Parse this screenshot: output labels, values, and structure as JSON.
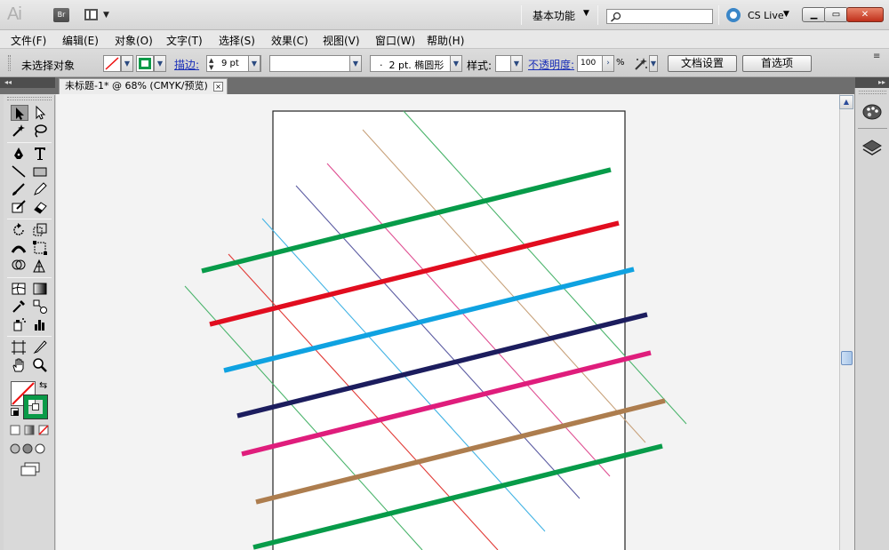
{
  "titlebar": {
    "app_logo": "Ai",
    "bridge_label": "Br",
    "workspace": "基本功能",
    "cs_live": "CS Live"
  },
  "menu": [
    "文件(F)",
    "编辑(E)",
    "对象(O)",
    "文字(T)",
    "选择(S)",
    "效果(C)",
    "视图(V)",
    "窗口(W)",
    "帮助(H)"
  ],
  "controlbar": {
    "no_selection": "未选择对象",
    "stroke_label": "描边:",
    "stroke_weight": "9 pt",
    "brush_profile": "2 pt. 椭圆形",
    "style_label": "样式:",
    "opacity_label": "不透明度:",
    "opacity_value": "100",
    "opacity_unit": "%",
    "document_setup": "文档设置",
    "preferences": "首选项",
    "stroke_color": "#0a9a48"
  },
  "document_tab": {
    "title": "未标题-1* @ 68% (CMYK/预览)",
    "close": "×"
  },
  "artwork": {
    "thick_line_colors": [
      "#079b49",
      "#e10d1f",
      "#0fa2e1",
      "#1c1d5e",
      "#df1d7c",
      "#ad7d4e",
      "#079b49"
    ],
    "thin_line_colors": [
      "#4bb46c",
      "#e13a36",
      "#42b3e4",
      "#5b5ba2",
      "#df4f92",
      "#c8a27b",
      "#4bb46c"
    ]
  }
}
